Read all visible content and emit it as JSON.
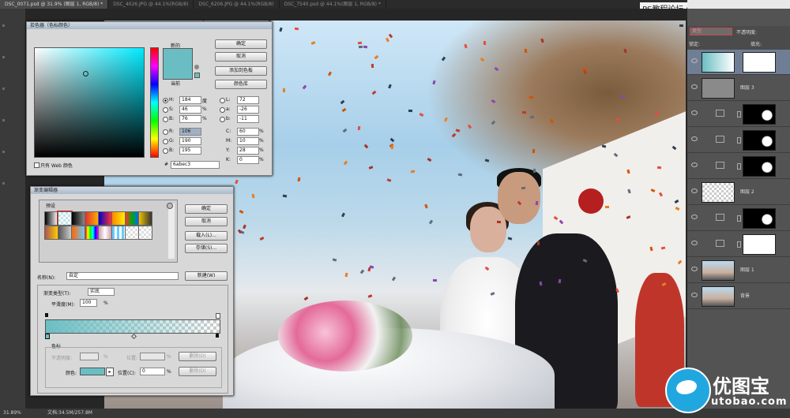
{
  "tabs": [
    {
      "label": "DSC_0071.psd @ 31.9% (图层 1, RGB/8) *",
      "active": true
    },
    {
      "label": "DSC_4026.JPG @ 44.1%(RGB/8)",
      "active": false
    },
    {
      "label": "DSC_6206.JPG @ 44.1%(RGB/8)",
      "active": false
    },
    {
      "label": "DSC_7540.psd @ 44.1%(图层 1, RGB/8) *",
      "active": false
    }
  ],
  "watermark": {
    "top": "PS教程论坛 www.16XX8.com",
    "logo_cn": "优图宝",
    "logo_en": "utobao.com"
  },
  "color_picker": {
    "title": "拾色器（色标颜色）",
    "new_label": "新的",
    "current_label": "当前",
    "ok": "确定",
    "cancel": "取消",
    "add_swatch": "添加到色板",
    "color_libraries": "颜色库",
    "H": {
      "label": "H:",
      "value": "184",
      "unit": "度"
    },
    "S": {
      "label": "S:",
      "value": "46",
      "unit": "%"
    },
    "B": {
      "label": "B:",
      "value": "76",
      "unit": "%"
    },
    "R": {
      "label": "R:",
      "value": "106"
    },
    "G": {
      "label": "G:",
      "value": "190"
    },
    "Bl": {
      "label": "B:",
      "value": "195"
    },
    "L": {
      "label": "L:",
      "value": "72"
    },
    "a": {
      "label": "a:",
      "value": "-26"
    },
    "b": {
      "label": "b:",
      "value": "-11"
    },
    "C": {
      "label": "C:",
      "value": "60",
      "unit": "%"
    },
    "M": {
      "label": "M:",
      "value": "10",
      "unit": "%"
    },
    "Y": {
      "label": "Y:",
      "value": "28",
      "unit": "%"
    },
    "K": {
      "label": "K:",
      "value": "0",
      "unit": "%"
    },
    "hex_label": "#",
    "hex": "6abec3",
    "web_only": "只有 Web 颜色",
    "color": "#6abec3"
  },
  "gradient_editor": {
    "title": "渐变编辑器",
    "presets_label": "预设",
    "ok": "确定",
    "cancel": "取消",
    "load": "载入(L)...",
    "save": "存储(S)...",
    "name_label": "名称(N):",
    "name_value": "自定",
    "new": "新建(W)",
    "type_label": "渐变类型(T):",
    "type_value": "实底",
    "smooth_label": "平滑度(M):",
    "smooth_value": "100",
    "smooth_unit": "%",
    "stops_label": "色标",
    "opacity_label": "不透明度:",
    "opacity_unit": "%",
    "location_label": "位置:",
    "location_unit": "%",
    "delete_opacity": "删除(D)",
    "color_label": "颜色:",
    "color_location_label": "位置(C):",
    "color_location_value": "0",
    "color_location_unit": "%",
    "delete_color": "删除(D)"
  },
  "layers_panel": {
    "search_placeholder": "类型",
    "opacity_label": "不透明度:",
    "fill_label": "填充:",
    "lock_label": "锁定:",
    "layers": [
      {
        "name": "",
        "kind": "gradient-mask",
        "selected": true
      },
      {
        "name": "图层 3",
        "kind": "gray"
      },
      {
        "name": "",
        "kind": "adjust-mask"
      },
      {
        "name": "",
        "kind": "adjust-mask"
      },
      {
        "name": "",
        "kind": "adjust-mask"
      },
      {
        "name": "图层 2",
        "kind": "transparent"
      },
      {
        "name": "",
        "kind": "adjust-mask"
      },
      {
        "name": "",
        "kind": "adjust-white"
      },
      {
        "name": "图层 1",
        "kind": "photo"
      },
      {
        "name": "背景",
        "kind": "photo"
      }
    ]
  },
  "status_bar": {
    "zoom": "31.89%",
    "doc": "文档:34.5M/257.8M"
  }
}
